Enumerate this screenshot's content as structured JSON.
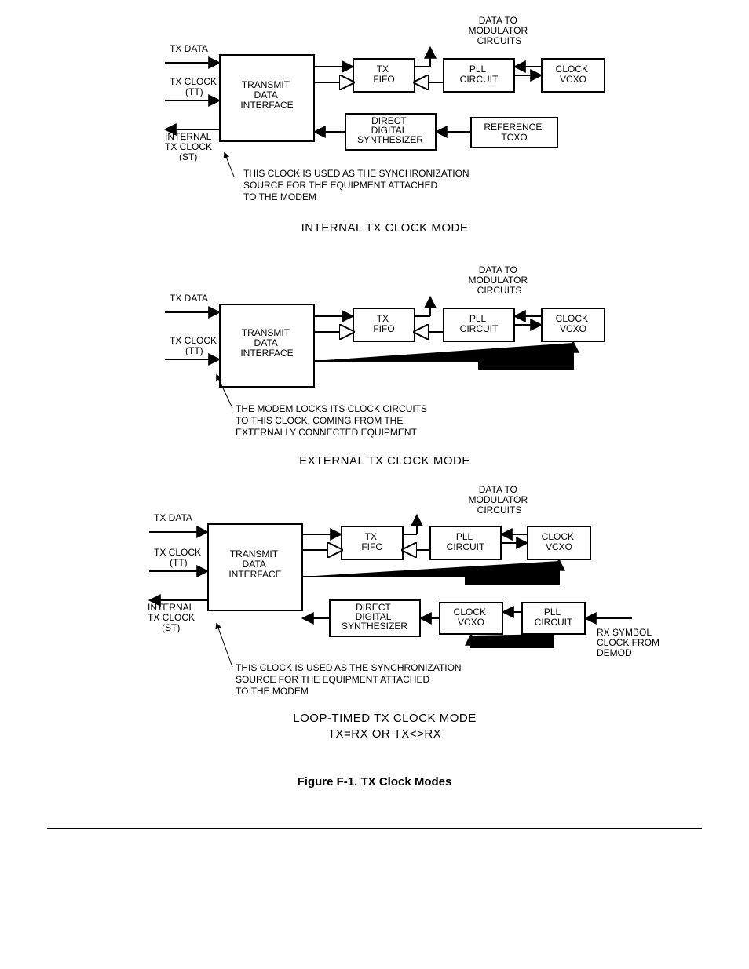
{
  "caption": "Figure F-1. TX Clock Modes",
  "common": {
    "tx_data": "TX DATA",
    "tx_clock": "TX CLOCK",
    "tx_clock_sub": "(TT)",
    "internal_tx_clock": "INTERNAL",
    "internal_tx_clock2": "TX CLOCK",
    "internal_tx_clock_sub": "(ST)",
    "data_to": "DATA TO",
    "modulator": "MODULATOR",
    "circuits": "CIRCUITS",
    "transmit": "TRANSMIT",
    "data_word": "DATA",
    "interface": "INTERFACE",
    "tx_fifo1": "TX",
    "tx_fifo2": "FIFO",
    "pll": "PLL",
    "circuit": "CIRCUIT",
    "clock": "CLOCK",
    "vcxo": "VCXO",
    "direct": "DIRECT",
    "digital": "DIGITAL",
    "synth": "SYNTHESIZER",
    "reference": "REFERENCE",
    "tcxo": "TCXO"
  },
  "d1": {
    "title": "INTERNAL TX CLOCK MODE",
    "note1": "THIS CLOCK IS USED AS THE SYNCHRONIZATION",
    "note2": "SOURCE FOR THE EQUIPMENT ATTACHED",
    "note3": "TO THE MODEM"
  },
  "d2": {
    "title": "EXTERNAL TX CLOCK MODE",
    "data_word": "DATA",
    "note1": "THE MODEM LOCKS ITS CLOCK CIRCUITS",
    "note2": "TO THIS CLOCK, COMING FROM THE",
    "note3": "EXTERNALLY CONNECTED EQUIPMENT"
  },
  "d3": {
    "title1": "LOOP-TIMED TX CLOCK MODE",
    "title2": "TX=RX  OR TX<>RX",
    "rx1": "RX SYMBOL",
    "rx2": "CLOCK FROM",
    "rx3": "DEMOD",
    "note1": "THIS CLOCK IS USED AS THE SYNCHRONIZATION",
    "note2": "SOURCE FOR THE EQUIPMENT ATTACHED",
    "note3": "TO THE MODEM"
  }
}
